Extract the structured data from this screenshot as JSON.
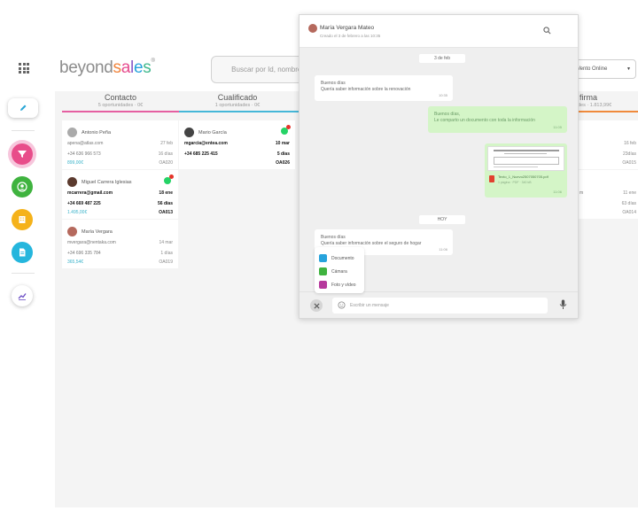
{
  "topbar": {
    "search_placeholder": "Buscar por Id, nombre...",
    "select_value": "Vento Online"
  },
  "columns": [
    {
      "name": "Contacto",
      "sub": "5 oportunidades · 0€",
      "color": "#e55fa1"
    },
    {
      "name": "Cualificado",
      "sub": "1 oportunidades · 0€",
      "color": "#45b7d8"
    },
    {
      "name": "firma",
      "sub": "des · 1.813,99€",
      "color": "#f08a3c"
    }
  ],
  "contacto_cards": [
    {
      "name": "Antonio Peña",
      "email": "apena@atlas.com",
      "date": "27 feb",
      "phone": "+34 636 966 573",
      "days": "16 días",
      "amount": "899,00€",
      "code": "OA020"
    },
    {
      "name": "Miguel Carrera Iglesias",
      "email": "mcarrera@gmail.com",
      "date": "18 ene",
      "phone": "+34 669 487 225",
      "days": "56 días",
      "amount": "1.495,00€",
      "code": "OA013"
    },
    {
      "name": "María Vergara",
      "email": "mvergara@nentaka.com",
      "date": "14 mar",
      "phone": "+34 696 335 784",
      "days": "1 días",
      "amount": "365,54€",
      "code": "OA019"
    }
  ],
  "cualificado_card": {
    "name": "Mario García",
    "email": "mgarcia@entea.com",
    "date": "10 mar",
    "phone": "+34 685 225 415",
    "days": "5 días",
    "code": "OA026"
  },
  "firma_cards": [
    {
      "date": "16 feb",
      "days": "23días",
      "code": "OA015"
    },
    {
      "prefix": "m",
      "date": "11 ene",
      "days": "63 días",
      "code": "OA014"
    }
  ],
  "chat": {
    "contact_name": "María Vergara Mateo",
    "subtitle": "Creado el 3 de febrero a las 10:35",
    "date_1": "3 de feb",
    "msg_1_greeting": "Buenos días",
    "msg_1_body": "Quería saber información sobre la renovación",
    "msg_1_time": "10:35",
    "msg_2_greeting": "Buenos días,",
    "msg_2_body": "Le comparto un documento con toda la información",
    "msg_2_time": "11:05",
    "file_name": "Texto_1_Nuevo2507050705.pdf",
    "file_meta": "1 página · PDF · 340 kB",
    "file_time": "11:06",
    "date_2": "HOY",
    "msg_3_greeting": "Buenos días",
    "msg_3_body": "Quería saber información sobre el seguro de hogar",
    "msg_3_time": "11:06",
    "attach_options": [
      "Documento",
      "Cámara",
      "Foto y vídeo"
    ],
    "input_placeholder": "Escribir un mensaje"
  }
}
